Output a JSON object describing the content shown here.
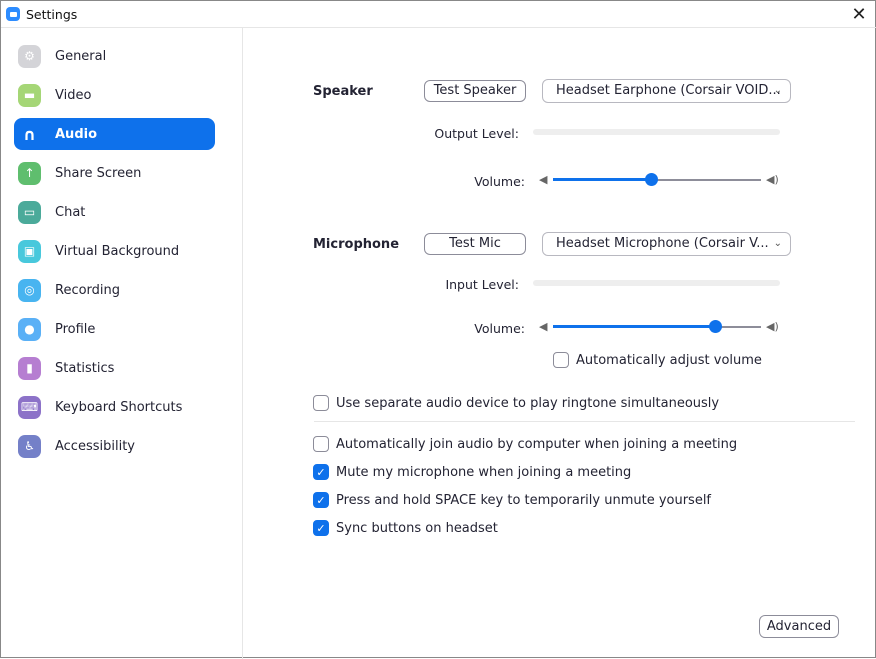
{
  "window": {
    "title": "Settings",
    "close_icon": "close-icon"
  },
  "sidebar": {
    "items": [
      {
        "label": "General",
        "icon": "gear-icon",
        "color": "#d4d4d8",
        "glyph": "⚙"
      },
      {
        "label": "Video",
        "icon": "video-camera-icon",
        "color": "#a5d676",
        "glyph": "▬"
      },
      {
        "label": "Audio",
        "icon": "headphones-icon",
        "color": "#0e71eb",
        "glyph": "∩",
        "active": true
      },
      {
        "label": "Share Screen",
        "icon": "share-screen-icon",
        "color": "#5fbe6e",
        "glyph": "↑"
      },
      {
        "label": "Chat",
        "icon": "chat-bubble-icon",
        "color": "#4baa9a",
        "glyph": "▭"
      },
      {
        "label": "Virtual Background",
        "icon": "virtual-background-icon",
        "color": "#48c8dc",
        "glyph": "▣"
      },
      {
        "label": "Recording",
        "icon": "recording-icon",
        "color": "#48b4f0",
        "glyph": "◎"
      },
      {
        "label": "Profile",
        "icon": "profile-icon",
        "color": "#5ab0f6",
        "glyph": "●"
      },
      {
        "label": "Statistics",
        "icon": "statistics-icon",
        "color": "#b67ed1",
        "glyph": "▮"
      },
      {
        "label": "Keyboard Shortcuts",
        "icon": "keyboard-icon",
        "color": "#8c72c8",
        "glyph": "⌨"
      },
      {
        "label": "Accessibility",
        "icon": "accessibility-icon",
        "color": "#7480c8",
        "glyph": "♿"
      }
    ]
  },
  "speaker": {
    "label": "Speaker",
    "test_button": "Test Speaker",
    "device": "Headset Earphone (Corsair VOID...",
    "output_level_label": "Output Level:",
    "output_level": 0,
    "volume_label": "Volume:",
    "volume": 0.47
  },
  "microphone": {
    "label": "Microphone",
    "test_button": "Test Mic",
    "device": "Headset Microphone (Corsair V...",
    "input_level_label": "Input Level:",
    "input_level": 0,
    "volume_label": "Volume:",
    "volume": 0.78,
    "auto_adjust_label": "Automatically adjust volume",
    "auto_adjust": false
  },
  "options": [
    {
      "label": "Use separate audio device to play ringtone simultaneously",
      "checked": false
    },
    {
      "label": "Automatically join audio by computer when joining a meeting",
      "checked": false
    },
    {
      "label": "Mute my microphone when joining a meeting",
      "checked": true
    },
    {
      "label": "Press and hold SPACE key to temporarily unmute yourself",
      "checked": true
    },
    {
      "label": "Sync buttons on headset",
      "checked": true
    }
  ],
  "advanced_button": "Advanced",
  "accent": "#0e71eb"
}
